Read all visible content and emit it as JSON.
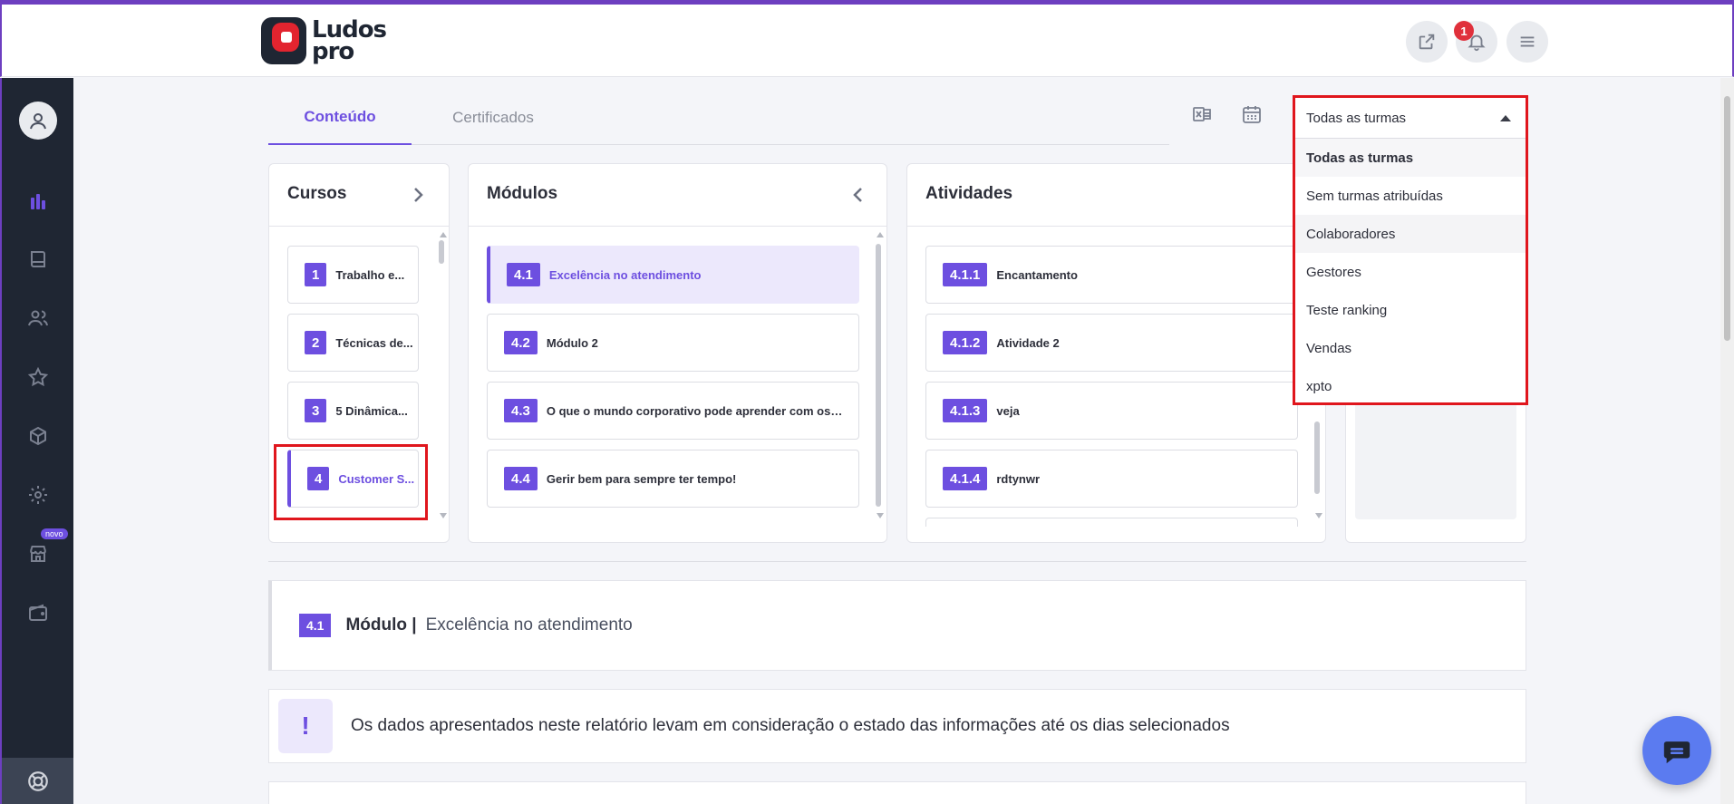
{
  "header": {
    "logo_line1": "Ludos",
    "logo_line2": "pro",
    "notification_count": "1"
  },
  "sidebar": {
    "novo_badge": "novo",
    "items": [
      "avatar-icon",
      "chart-icon",
      "book-icon",
      "users-icon",
      "star-icon",
      "box-icon",
      "gear-icon",
      "store-icon",
      "wallet-icon",
      "support-icon"
    ]
  },
  "tabs": [
    {
      "label": "Conteúdo",
      "active": true
    },
    {
      "label": "Certificados",
      "active": false
    }
  ],
  "filter": {
    "selected": "Todas as turmas",
    "options": [
      "Todas as turmas",
      "Sem turmas atribuídas",
      "Colaboradores",
      "Gestores",
      "Teste ranking",
      "Vendas",
      "xpto"
    ]
  },
  "cursos": {
    "title": "Cursos",
    "items": [
      {
        "num": "1",
        "label": "Trabalho e..."
      },
      {
        "num": "2",
        "label": "Técnicas de..."
      },
      {
        "num": "3",
        "label": "5 Dinâmica..."
      },
      {
        "num": "4",
        "label": "Customer S..."
      }
    ]
  },
  "modulos": {
    "title": "Módulos",
    "items": [
      {
        "num": "4.1",
        "label": "Excelência no atendimento"
      },
      {
        "num": "4.2",
        "label": "Módulo 2"
      },
      {
        "num": "4.3",
        "label": "O que o mundo corporativo pode aprender com os atle..."
      },
      {
        "num": "4.4",
        "label": "Gerir bem para sempre ter tempo!"
      }
    ]
  },
  "atividades": {
    "title": "Atividades",
    "items": [
      {
        "num": "4.1.1",
        "label": "Encantamento"
      },
      {
        "num": "4.1.2",
        "label": "Atividade 2"
      },
      {
        "num": "4.1.3",
        "label": "veja"
      },
      {
        "num": "4.1.4",
        "label": "rdtynwr"
      }
    ]
  },
  "module_bar": {
    "num": "4.1",
    "label": "Módulo |",
    "name": "Excelência no atendimento"
  },
  "info": {
    "icon": "!",
    "text": "Os dados apresentados neste relatório levam em consideração o estado das informações até os dias selecionados"
  },
  "colors": {
    "accent": "#6d4fe0",
    "sidebar_bg": "#1f2633",
    "highlight_red": "#e0161d",
    "badge_red": "#e0303b"
  }
}
